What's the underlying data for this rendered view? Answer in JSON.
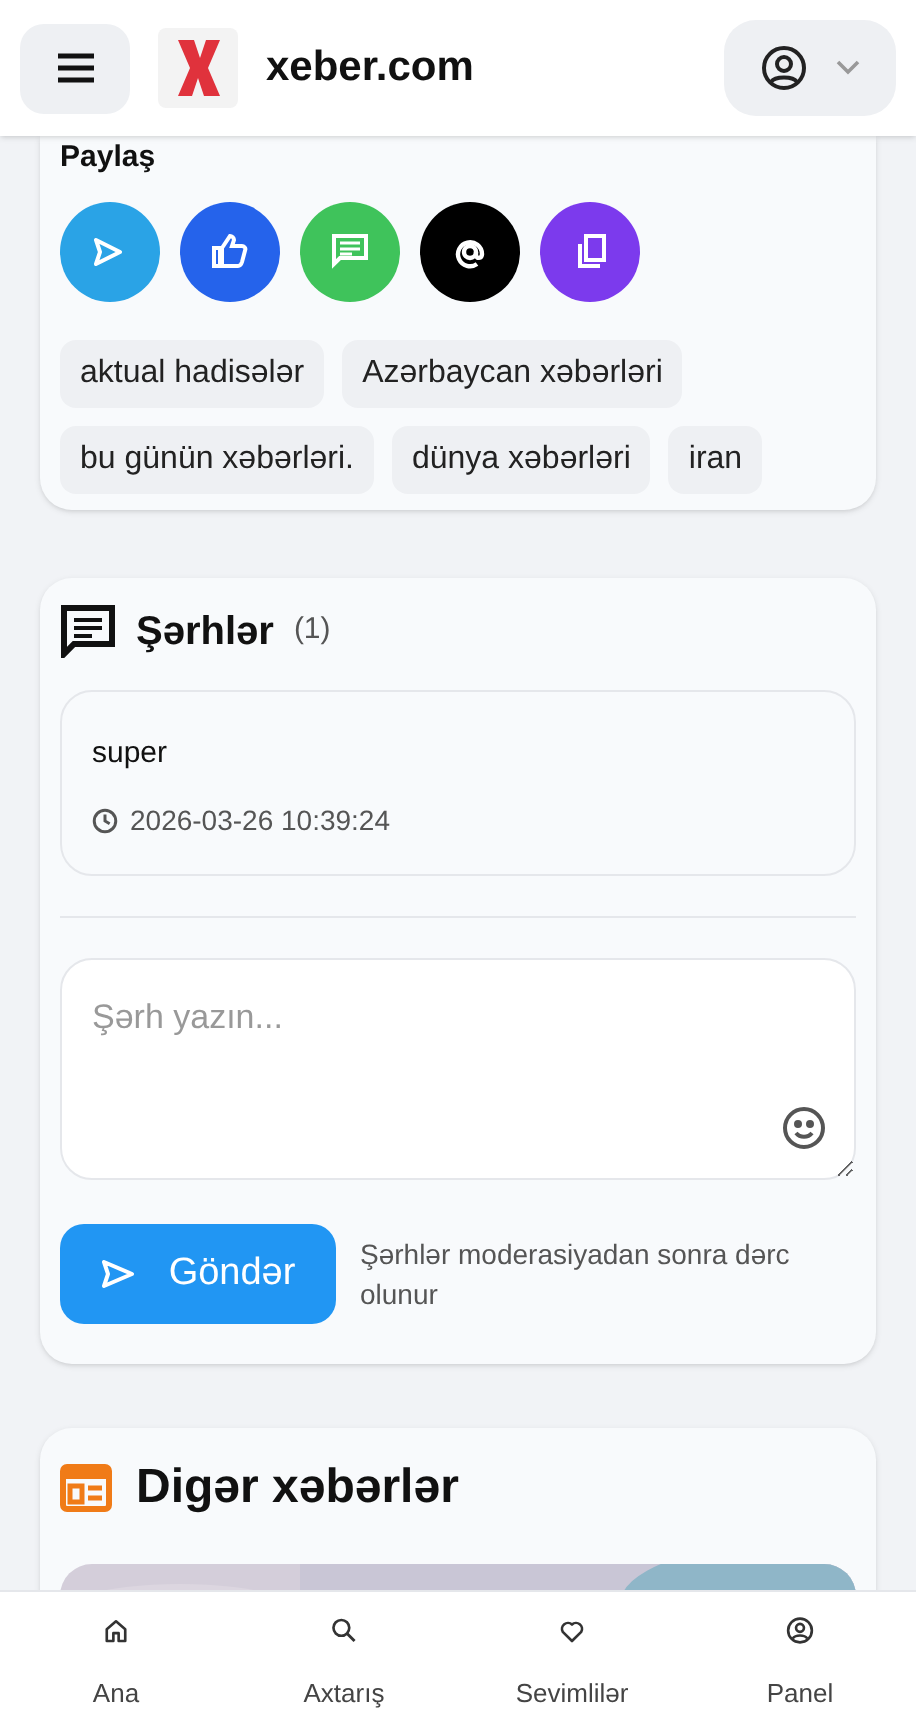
{
  "header": {
    "site_name": "xeber.com"
  },
  "share": {
    "title": "Paylaş",
    "buttons": [
      {
        "kind": "send",
        "color": "#2aa3e6"
      },
      {
        "kind": "like",
        "color": "#2563eb"
      },
      {
        "kind": "message",
        "color": "#3fc35b"
      },
      {
        "kind": "at",
        "color": "#000000"
      },
      {
        "kind": "copy",
        "color": "#7c3aed"
      }
    ],
    "tags": [
      "aktual hadisələr",
      "Azərbaycan xəbərləri",
      "bu günün xəbərləri.",
      "dünya xəbərləri",
      "iran"
    ]
  },
  "comments": {
    "title": "Şərhlər",
    "count": "(1)",
    "items": [
      {
        "text": "super",
        "time": "2026-03-26 10:39:24"
      }
    ],
    "input": {
      "placeholder": "Şərh yazın..."
    },
    "submit": "Göndər",
    "note": "Şərhlər moderasiyadan sonra dərc olunur"
  },
  "other_news": {
    "title": "Digər xəbərlər"
  },
  "bottom_nav": [
    {
      "kind": "home",
      "label": "Ana"
    },
    {
      "kind": "search",
      "label": "Axtarış"
    },
    {
      "kind": "heart",
      "label": "Sevimlilər"
    },
    {
      "kind": "user",
      "label": "Panel"
    }
  ]
}
